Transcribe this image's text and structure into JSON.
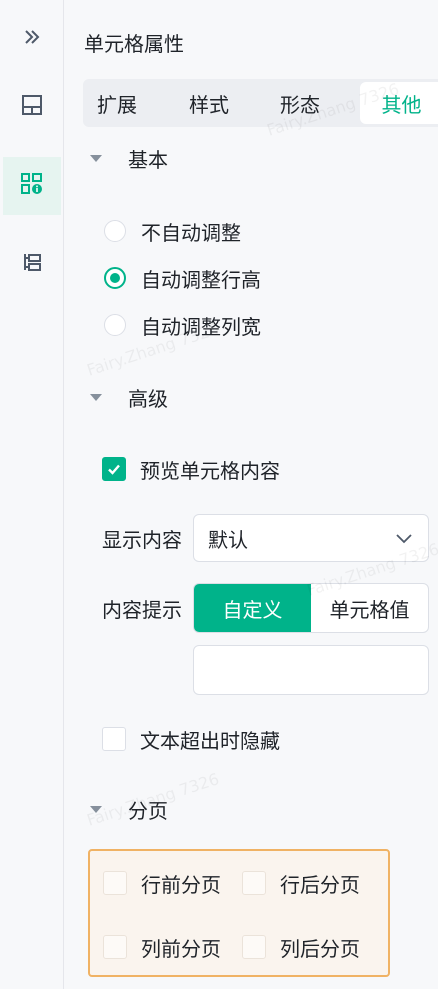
{
  "rail": {
    "items": [
      {
        "icon": "expand-chevrons-icon"
      },
      {
        "icon": "layout-grid-icon"
      },
      {
        "icon": "cell-info-icon",
        "active": true
      },
      {
        "icon": "hierarchy-icon"
      }
    ]
  },
  "panel": {
    "title": "单元格属性",
    "tabs": [
      {
        "label": "扩展"
      },
      {
        "label": "样式"
      },
      {
        "label": "形态"
      },
      {
        "label": "其他",
        "active": true
      }
    ]
  },
  "basic": {
    "label": "基本",
    "options": [
      {
        "label": "不自动调整",
        "selected": false
      },
      {
        "label": "自动调整行高",
        "selected": true
      },
      {
        "label": "自动调整列宽",
        "selected": false
      }
    ]
  },
  "advanced": {
    "label": "高级",
    "preview_label": "预览单元格内容",
    "preview_checked": true,
    "display_label": "显示内容",
    "display_value": "默认",
    "hint_label": "内容提示",
    "hint_options": [
      "自定义",
      "单元格值"
    ],
    "hint_active": "自定义",
    "hint_input_value": "",
    "overflow_label": "文本超出时隐藏",
    "overflow_checked": false
  },
  "paging": {
    "label": "分页",
    "items": [
      {
        "label": "行前分页",
        "checked": false
      },
      {
        "label": "行后分页",
        "checked": false
      },
      {
        "label": "列前分页",
        "checked": false
      },
      {
        "label": "列后分页",
        "checked": false
      }
    ]
  },
  "watermark": "Fairy.Zhang 7326",
  "colors": {
    "accent": "#00b38a",
    "highlight_border": "#f0b264",
    "highlight_bg": "#faf4ee"
  }
}
